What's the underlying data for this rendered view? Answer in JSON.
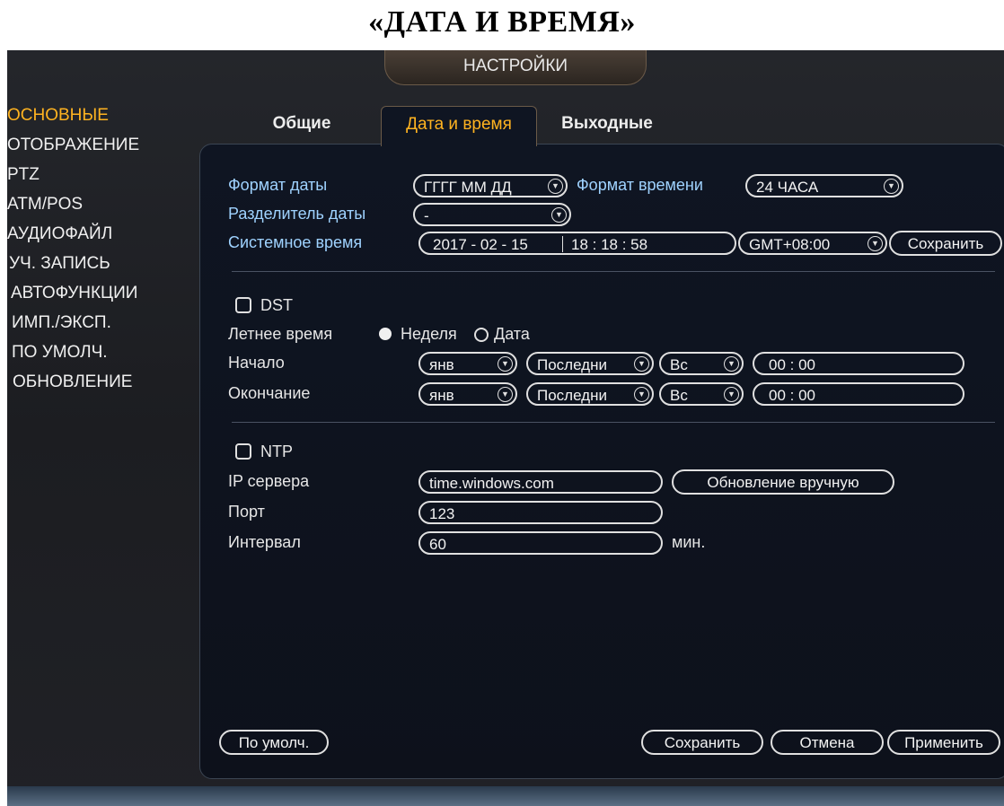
{
  "document": {
    "heading": "«ДАТА И ВРЕМЯ»"
  },
  "title": "НАСТРОЙКИ",
  "sidebar": {
    "items": [
      {
        "label": "ОСНОВНЫЕ",
        "active": true
      },
      {
        "label": "ОТОБРАЖЕНИЕ"
      },
      {
        "label": "PTZ"
      },
      {
        "label": "ATM/POS"
      },
      {
        "label": "АУДИОФАЙЛ"
      },
      {
        "label": "УЧ. ЗАПИСЬ"
      },
      {
        "label": "АВТОФУНКЦИИ"
      },
      {
        "label": "ИМП./ЭКСП."
      },
      {
        "label": "ПО УМОЛЧ."
      },
      {
        "label": "ОБНОВЛЕНИЕ"
      }
    ]
  },
  "tabs": [
    {
      "label": "Общие"
    },
    {
      "label": "Дата и время",
      "active": true
    },
    {
      "label": "Выходные"
    }
  ],
  "form": {
    "date_format_label": "Формат даты",
    "date_format_value": "ГГГГ ММ ДД",
    "time_format_label": "Формат времени",
    "time_format_value": "24 ЧАСА",
    "date_separator_label": "Разделитель даты",
    "date_separator_value": "-",
    "system_time_label": "Системное время",
    "system_date_value": "2017 - 02 - 15",
    "system_clock_value": "18 : 18 : 58",
    "timezone_value": "GMT+08:00",
    "save_time_label": "Сохранить",
    "dst_label": "DST",
    "summer_time_label": "Летнее время",
    "mode_week_label": "Неделя",
    "mode_date_label": "Дата",
    "start_label": "Начало",
    "start_month": "янв",
    "start_week": "Последни",
    "start_day": "Вс",
    "start_time": "00 :  00",
    "end_label": "Окончание",
    "end_month": "янв",
    "end_week": "Последни",
    "end_day": "Вс",
    "end_time": "00 :  00",
    "ntp_label": "NTP",
    "server_ip_label": "IP сервера",
    "server_ip_value": "time.windows.com",
    "manual_update_label": "Обновление вручную",
    "port_label": "Порт",
    "port_value": "123",
    "interval_label": "Интервал",
    "interval_value": "60",
    "interval_unit": "мин."
  },
  "footer": {
    "default_label": "По умолч.",
    "save_label": "Сохранить",
    "cancel_label": "Отмена",
    "apply_label": "Применить"
  },
  "colors": {
    "accent": "#ffb320",
    "text": "#e6e6e6",
    "background": "#1c1d21"
  }
}
